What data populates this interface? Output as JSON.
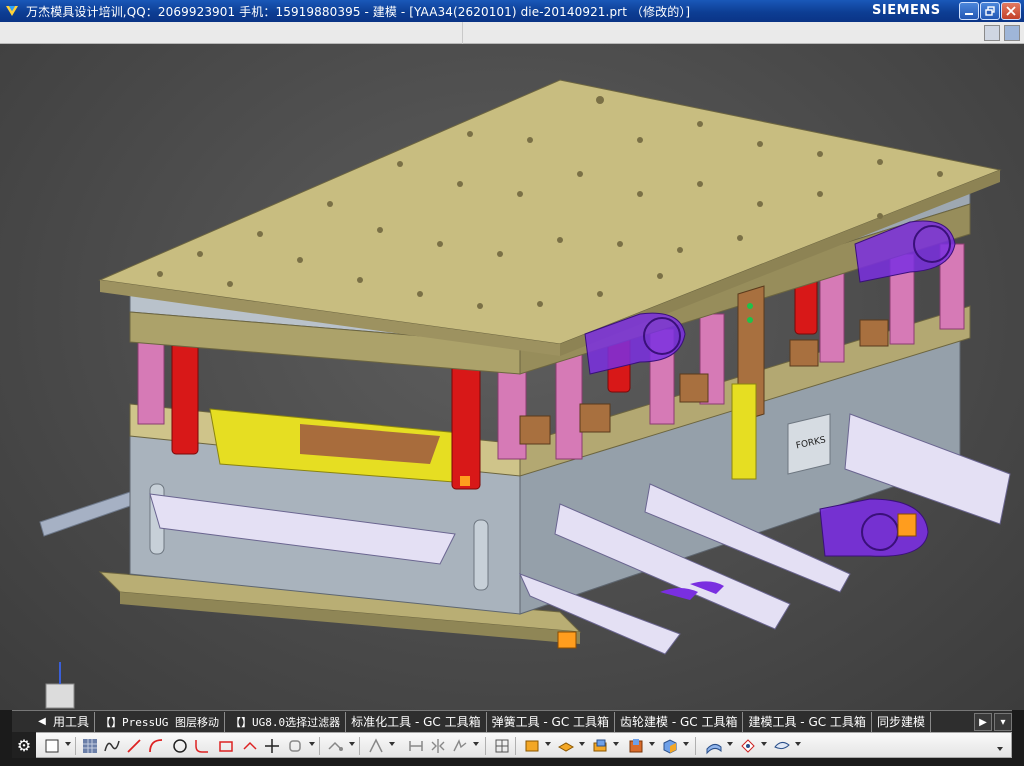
{
  "window": {
    "title": "万杰模具设计培训,QQ：2069923901 手机：15919880395 - 建模 - [YAA34(2620101) die-20140921.prt （修改的）]",
    "brand": "SIEMENS",
    "icons": [
      "nx-app-icon",
      "minimize-icon",
      "restore-icon",
      "close-icon"
    ]
  },
  "viewport": {
    "part_label": "FORKS",
    "background": "#4e4e4e",
    "colors": {
      "plate": "#c8bd80",
      "plate_dark": "#8f8a5e",
      "steel": "#a8b2bc",
      "steel_dark": "#7e8892",
      "pink": "#d67ab6",
      "red": "#d81818",
      "purple": "#7a2fe0",
      "yellow": "#e8e020",
      "brown": "#a06a3a",
      "chute": "#e4e0f4",
      "orange": "#ff9d1e"
    }
  },
  "tabbar": {
    "tabs": [
      {
        "label": "用工具"
      },
      {
        "label": "【】PressUG 图层移动"
      },
      {
        "label": "【】UG8.0选择过滤器"
      },
      {
        "label": "标准化工具 - GC 工具箱"
      },
      {
        "label": "弹簧工具 - GC 工具箱"
      },
      {
        "label": "齿轮建模 - GC 工具箱"
      },
      {
        "label": "建模工具 - GC 工具箱"
      },
      {
        "label": "同步建模"
      }
    ]
  },
  "toolbar": {
    "tools": [
      "sketch-select-icon",
      "grid-icon",
      "spline-icon",
      "line-icon",
      "arc-icon",
      "circle-icon",
      "fillet-icon",
      "rectangle-icon",
      "point-icon",
      "plus-icon",
      "offset-icon",
      "constraint-icon",
      "trim-icon",
      "dimension-icon",
      "mirror-icon",
      "pattern-icon",
      "extrude-icon",
      "revolve-icon",
      "block-icon",
      "cylinder-icon",
      "cone-icon",
      "sphere-icon",
      "surface-icon",
      "view-icon"
    ]
  }
}
